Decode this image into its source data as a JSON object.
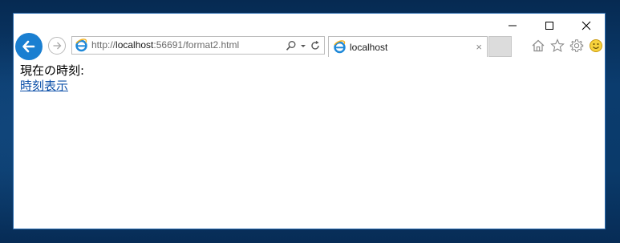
{
  "browser": {
    "url_prefix": "http://",
    "url_host": "localhost",
    "url_rest": ":56691/format2.html",
    "tab_title": "localhost",
    "tab_close": "×"
  },
  "page": {
    "time_label": "現在の時刻:",
    "show_time_link": "時刻表示"
  },
  "colors": {
    "accent": "#1a7fd1",
    "link": "#0b4fa8"
  },
  "icons": {
    "back": "back-arrow-icon",
    "forward": "forward-arrow-icon",
    "ie": "internet-explorer-icon",
    "search": "search-icon",
    "refresh": "refresh-icon",
    "home": "home-icon",
    "favorites": "star-icon",
    "settings": "gear-icon",
    "feedback": "smiley-icon"
  }
}
